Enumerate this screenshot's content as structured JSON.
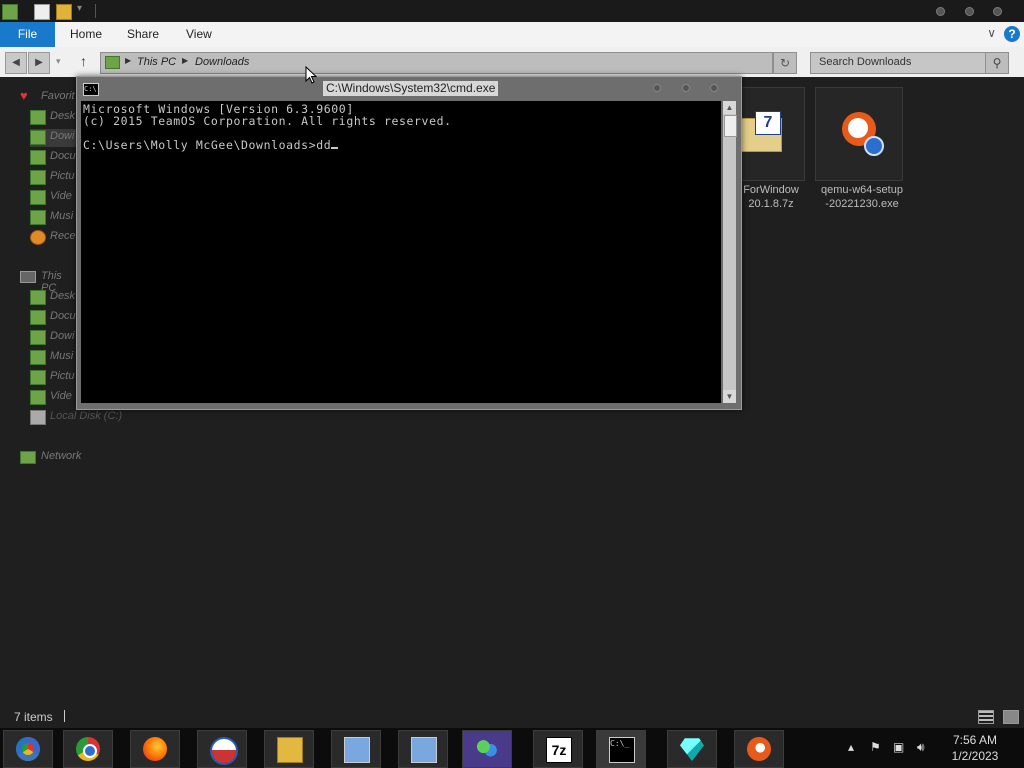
{
  "window": {
    "quick_access_icons": [
      "properties-icon",
      "new-folder-icon",
      "customize-arrow-icon"
    ]
  },
  "ribbon": {
    "tabs": [
      "File",
      "Home",
      "Share",
      "View"
    ],
    "help_label": "?"
  },
  "address_bar": {
    "breadcrumbs": [
      "This PC",
      "Downloads"
    ],
    "search_placeholder": "Search Downloads"
  },
  "sidebar": {
    "favorites": {
      "label": "Favorit",
      "items": [
        "Desk",
        "Dowi",
        "Docu",
        "Pictu",
        "Vide",
        "Musi",
        "Rece"
      ]
    },
    "this_pc": {
      "label": "This PC",
      "items": [
        "Desk",
        "Docu",
        "Dowi",
        "Musi",
        "Pictu",
        "Vide",
        "Local Disk (C:)"
      ]
    },
    "network": {
      "label": "Network"
    }
  },
  "files": [
    {
      "name_line1": "ForWindow",
      "name_line2": "20.1.8.7z",
      "icon": "7zip-archive-icon"
    },
    {
      "name_line1": "qemu-w64-setup",
      "name_line2": "-20221230.exe",
      "icon": "qemu-installer-icon"
    }
  ],
  "cmd": {
    "title": "C:\\Windows\\System32\\cmd.exe",
    "line1": "Microsoft Windows [Version 6.3.9600]",
    "line2": "(c) 2015 TeamOS Corporation. All rights reserved.",
    "line3": "",
    "prompt": "C:\\Users\\Molly McGee\\Downloads>dd"
  },
  "status_bar": {
    "item_count": "7 items"
  },
  "taskbar": {
    "apps": [
      "chrome-remote-icon",
      "chrome-icon",
      "firefox-icon",
      "obama-logo-icon",
      "file-explorer-icon",
      "installer-icon",
      "installer-icon-2",
      "windows-live-icon",
      "7zip-icon",
      "cmd-icon",
      "diamond-icon",
      "qemu-icon"
    ],
    "time": "7:56 AM",
    "date": "1/2/2023"
  },
  "colors": {
    "accent": "#1979ca",
    "console_bg": "#000000",
    "console_fg": "#c8c8c8",
    "explorer_bg": "#1f1f1f"
  }
}
